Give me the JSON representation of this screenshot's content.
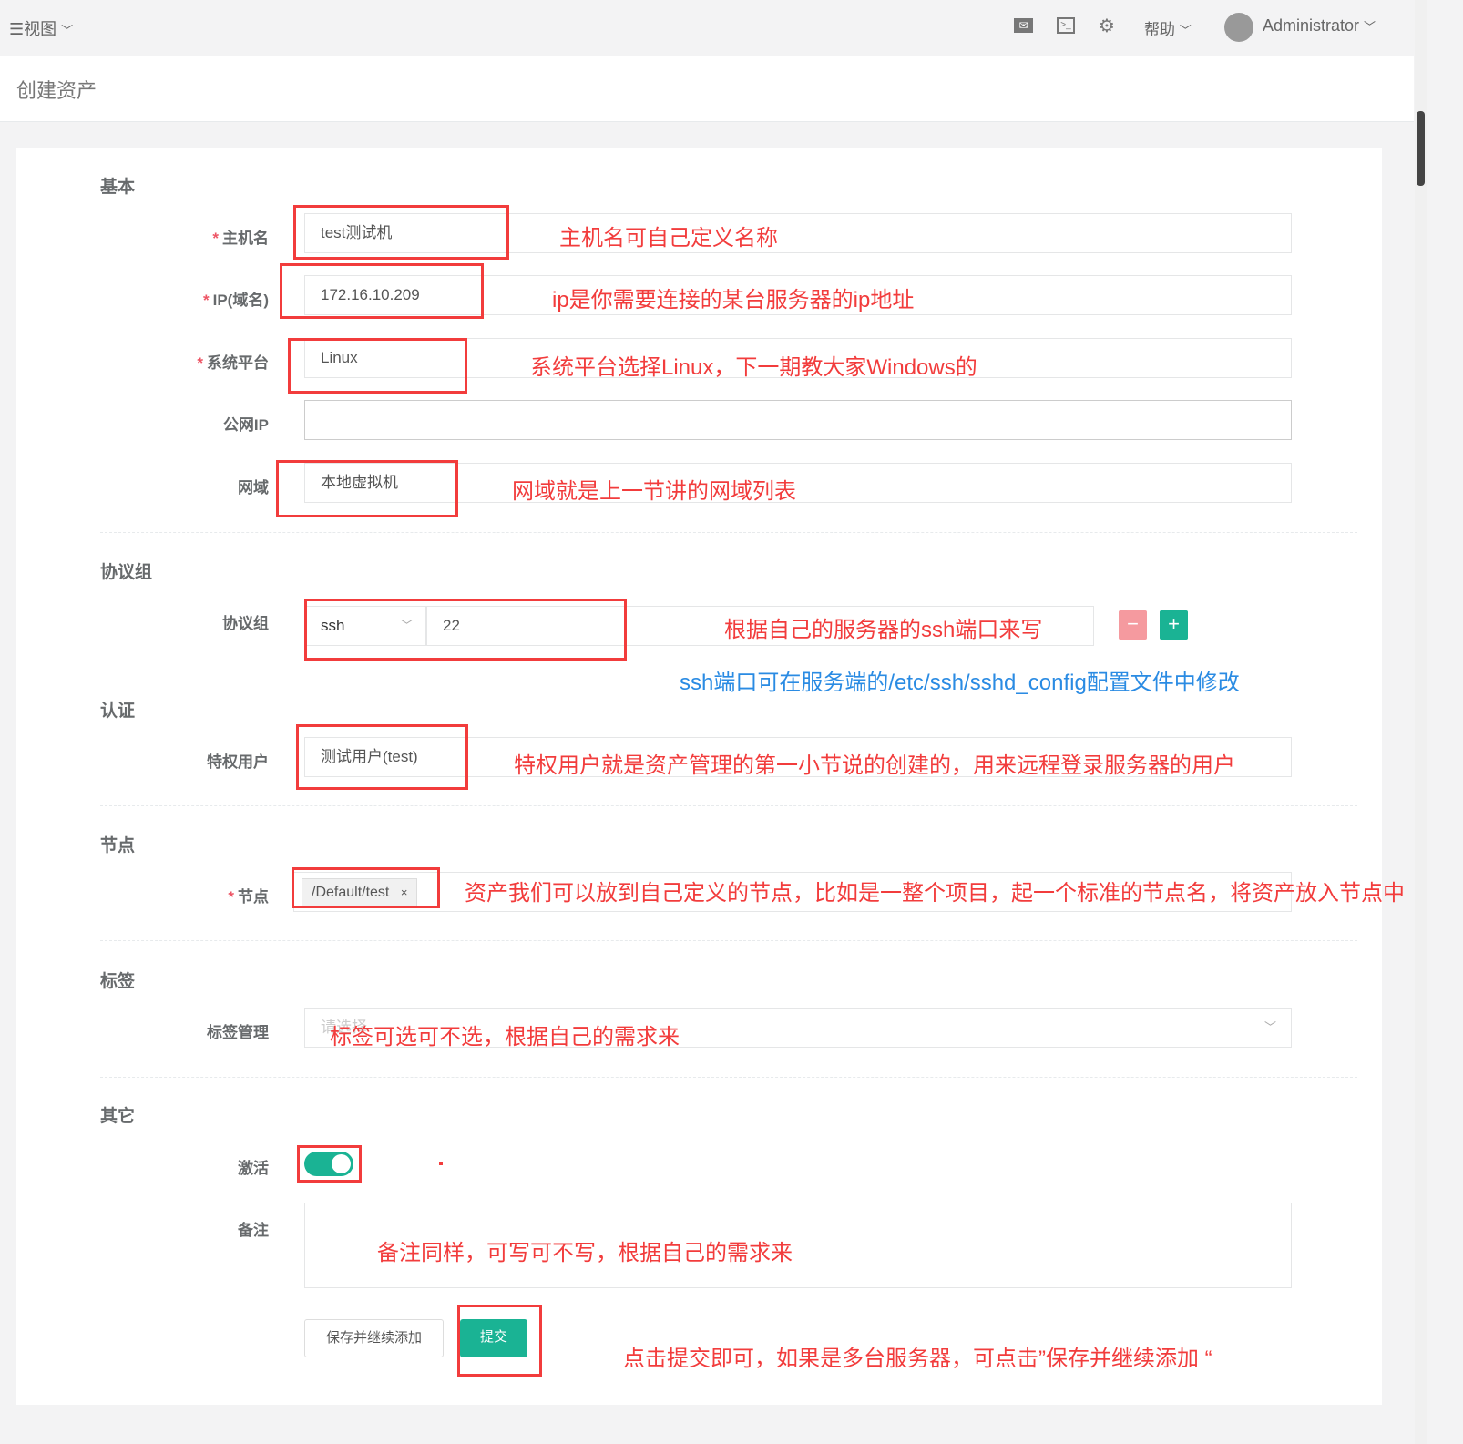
{
  "topbar": {
    "view_label": "视图",
    "help_label": "帮助",
    "user_name": "Administrator"
  },
  "page": {
    "title": "创建资产"
  },
  "sections": {
    "basic": "基本",
    "protocols": "协议组",
    "auth": "认证",
    "nodes": "节点",
    "labels": "标签",
    "other": "其它"
  },
  "fields": {
    "hostname": {
      "label": "主机名",
      "value": "test测试机"
    },
    "ip": {
      "label": "IP(域名)",
      "value": "172.16.10.209"
    },
    "platform": {
      "label": "系统平台",
      "value": "Linux"
    },
    "public_ip": {
      "label": "公网IP",
      "value": ""
    },
    "domain": {
      "label": "网域",
      "value": "本地虚拟机"
    },
    "protocol": {
      "label": "协议组",
      "name": "ssh",
      "port": "22"
    },
    "admin_user": {
      "label": "特权用户",
      "value": "测试用户(test)"
    },
    "node": {
      "label": "节点",
      "tag": "/Default/test"
    },
    "tags": {
      "label": "标签管理",
      "placeholder": "请选择"
    },
    "active": {
      "label": "激活",
      "on": true
    },
    "comment": {
      "label": "备注",
      "value": ""
    }
  },
  "buttons": {
    "save_continue": "保存并继续添加",
    "submit": "提交"
  },
  "annotations": {
    "hostname": "主机名可自己定义名称",
    "ip": "ip是你需要连接的某台服务器的ip地址",
    "platform": "系统平台选择Linux，下一期教大家Windows的",
    "domain": "网域就是上一节讲的网域列表",
    "protocol": "根据自己的服务器的ssh端口来写",
    "protocol_note": "ssh端口可在服务端的/etc/ssh/sshd_config配置文件中修改",
    "admin_user": "特权用户就是资产管理的第一小节说的创建的，用来远程登录服务器的用户",
    "node": "资产我们可以放到自己定义的节点，比如是一整个项目，起一个标准的节点名，将资产放入节点中",
    "tags": "标签可选可不选，根据自己的需求来",
    "comment": "备注同样，可写可不写，根据自己的需求来",
    "submit": "点击提交即可，如果是多台服务器，可点击”保存并继续添加 “"
  },
  "colors": {
    "primary": "#1ab394",
    "danger": "#ed5565",
    "annotation": "#f23c3c",
    "annotation_blue": "#2a8be3"
  }
}
